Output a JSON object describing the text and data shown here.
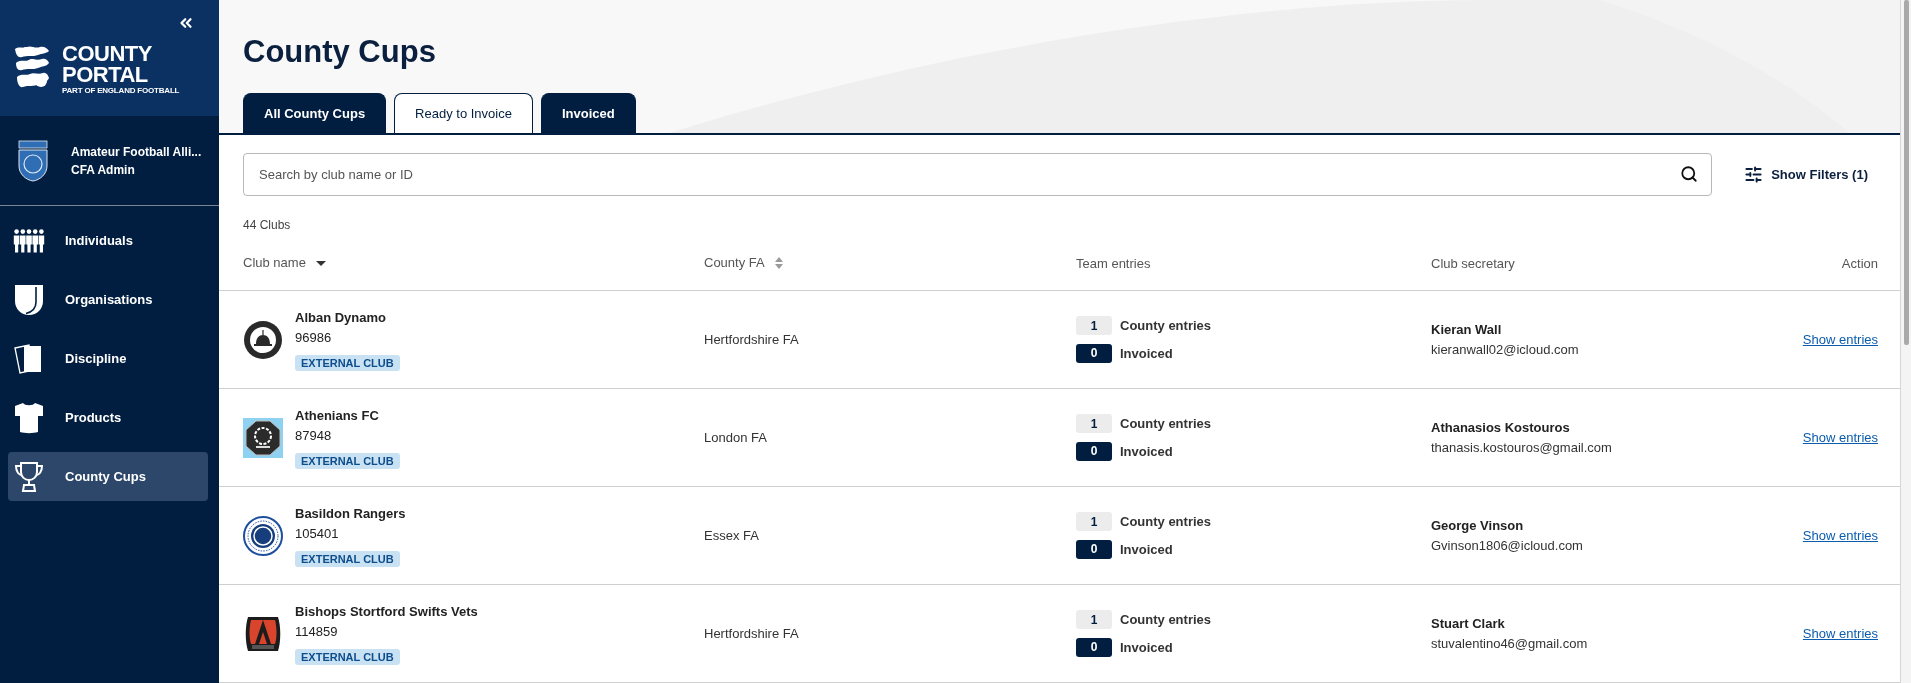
{
  "sidebar": {
    "logo": {
      "title_line_1": "COUNTY",
      "title_line_2": "PORTAL",
      "tagline": "PART OF ENGLAND FOOTBALL"
    },
    "organisation": {
      "name": "Amateur Football Alli...",
      "role": "CFA Admin"
    },
    "nav_items": [
      {
        "label": "Individuals",
        "selected": false
      },
      {
        "label": "Organisations",
        "selected": false
      },
      {
        "label": "Discipline",
        "selected": false
      },
      {
        "label": "Products",
        "selected": false
      },
      {
        "label": "County Cups",
        "selected": true
      }
    ]
  },
  "page": {
    "title": "County Cups",
    "tabs": [
      {
        "label": "All County Cups",
        "selected": false
      },
      {
        "label": "Ready to Invoice",
        "selected": true
      },
      {
        "label": "Invoiced",
        "selected": false
      }
    ],
    "search": {
      "placeholder": "Search by club name or ID"
    },
    "filters_button": {
      "label": "Show Filters (1)"
    },
    "result_count": "44 Clubs",
    "table": {
      "columns": [
        {
          "label": "Club name",
          "sortable": true,
          "sorted": true
        },
        {
          "label": "County FA",
          "sortable": true,
          "sorted": false
        },
        {
          "label": "Team entries",
          "sortable": false
        },
        {
          "label": "Club secretary",
          "sortable": false
        },
        {
          "label": "Action",
          "sortable": false
        }
      ],
      "rows": [
        {
          "club_name": "Alban Dynamo",
          "club_id": "96986",
          "tag": "EXTERNAL CLUB",
          "county_fa": "Hertfordshire FA",
          "county_entries": {
            "count": "1",
            "label": "County entries"
          },
          "invoiced": {
            "count": "0",
            "label": "Invoiced"
          },
          "secretary": {
            "name": "Kieran Wall",
            "email": "kieranwall02@icloud.com"
          },
          "action": "Show entries"
        },
        {
          "club_name": "Athenians FC",
          "club_id": "87948",
          "tag": "EXTERNAL CLUB",
          "county_fa": "London FA",
          "county_entries": {
            "count": "1",
            "label": "County entries"
          },
          "invoiced": {
            "count": "0",
            "label": "Invoiced"
          },
          "secretary": {
            "name": "Athanasios Kostouros",
            "email": "thanasis.kostouros@gmail.com"
          },
          "action": "Show entries"
        },
        {
          "club_name": "Basildon Rangers",
          "club_id": "105401",
          "tag": "EXTERNAL CLUB",
          "county_fa": "Essex FA",
          "county_entries": {
            "count": "1",
            "label": "County entries"
          },
          "invoiced": {
            "count": "0",
            "label": "Invoiced"
          },
          "secretary": {
            "name": "George Vinson",
            "email": "Gvinson1806@icloud.com"
          },
          "action": "Show entries"
        },
        {
          "club_name": "Bishops Stortford Swifts Vets",
          "club_id": "114859",
          "tag": "EXTERNAL CLUB",
          "county_fa": "Hertfordshire FA",
          "county_entries": {
            "count": "1",
            "label": "County entries"
          },
          "invoiced": {
            "count": "0",
            "label": "Invoiced"
          },
          "secretary": {
            "name": "Stuart Clark",
            "email": "stuvalentino46@gmail.com"
          },
          "action": "Show entries"
        }
      ]
    }
  }
}
